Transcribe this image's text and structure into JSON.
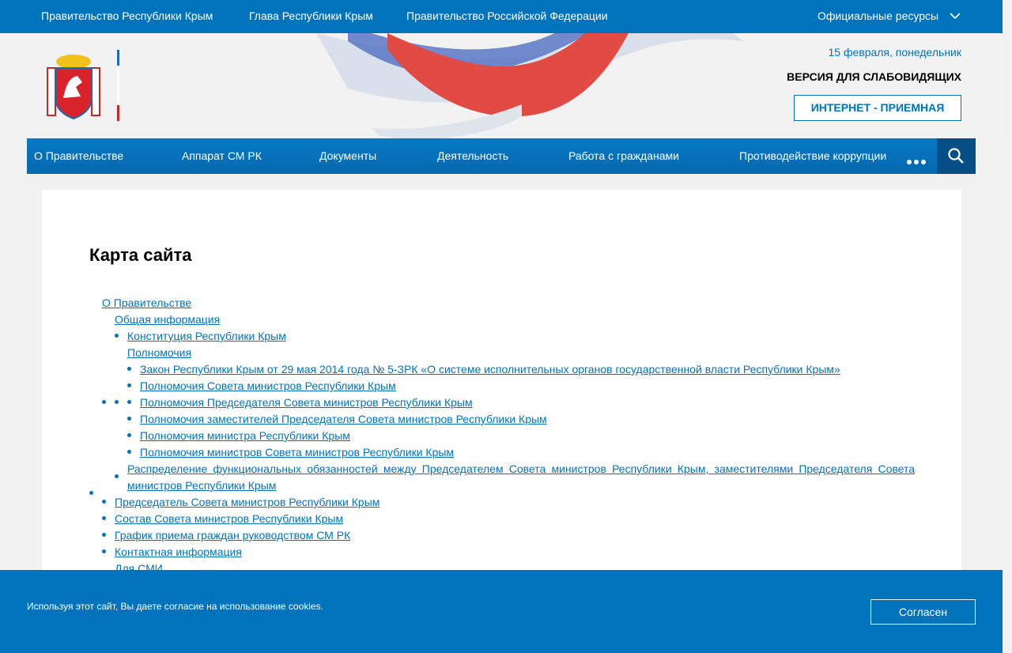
{
  "topbar": {
    "link1": "Правительство Республики Крым",
    "link2": "Глава Республики Крым",
    "link3": "Правительство Российской Федерации",
    "resources": "Официальные ресурсы"
  },
  "header": {
    "date": "15 февраля, понедельник",
    "vision": "ВЕРСИЯ ДЛЯ СЛАБОВИДЯЩИХ",
    "reception": "ИНТЕРНЕТ - ПРИЕМНАЯ"
  },
  "nav": [
    "О Правительстве",
    "Аппарат СМ РК",
    "Документы",
    "Деятельность",
    "Работа с гражданами",
    "Противодействие коррупции"
  ],
  "page": {
    "title": "Карта сайта",
    "links": [
      "О Правительстве",
      "Общая информация",
      "Конституция Республики Крым",
      "Полномочия",
      "Закон Республики Крым от 29 мая 2014 года № 5-ЗРК «О системе исполнительных органов государственной власти Республики Крым»",
      "Полномочия Совета министров Республики Крым",
      "Полномочия Председателя Совета министров Республики Крым",
      "Полномочия заместителей Председателя Совета министров Республики Крым",
      "Полномочия министра Республики Крым",
      "Полномочия министров Совета министров Республики Крым",
      "Распределение функциональных обязанностей между Председателем Совета министров Республики Крым, заместителями Председателя Совета министров Республики Крым",
      "Председатель Совета министров Республики Крым",
      "Состав Совета министров Республики Крым",
      "График приема граждан руководством СМ РК",
      "Контактная информация",
      "Для СМИ"
    ]
  },
  "cookie": {
    "text": "Используя этот сайт, Вы даете согласие на использование cookies.",
    "button": "Согласен"
  },
  "colors": {
    "primary": "#0073bd",
    "nav_dark": "#054f86"
  },
  "icons": {
    "dropdown": "chevron-down-icon",
    "more": "more-dots-icon",
    "search": "search-icon",
    "emblem": "crimea-emblem-icon"
  }
}
